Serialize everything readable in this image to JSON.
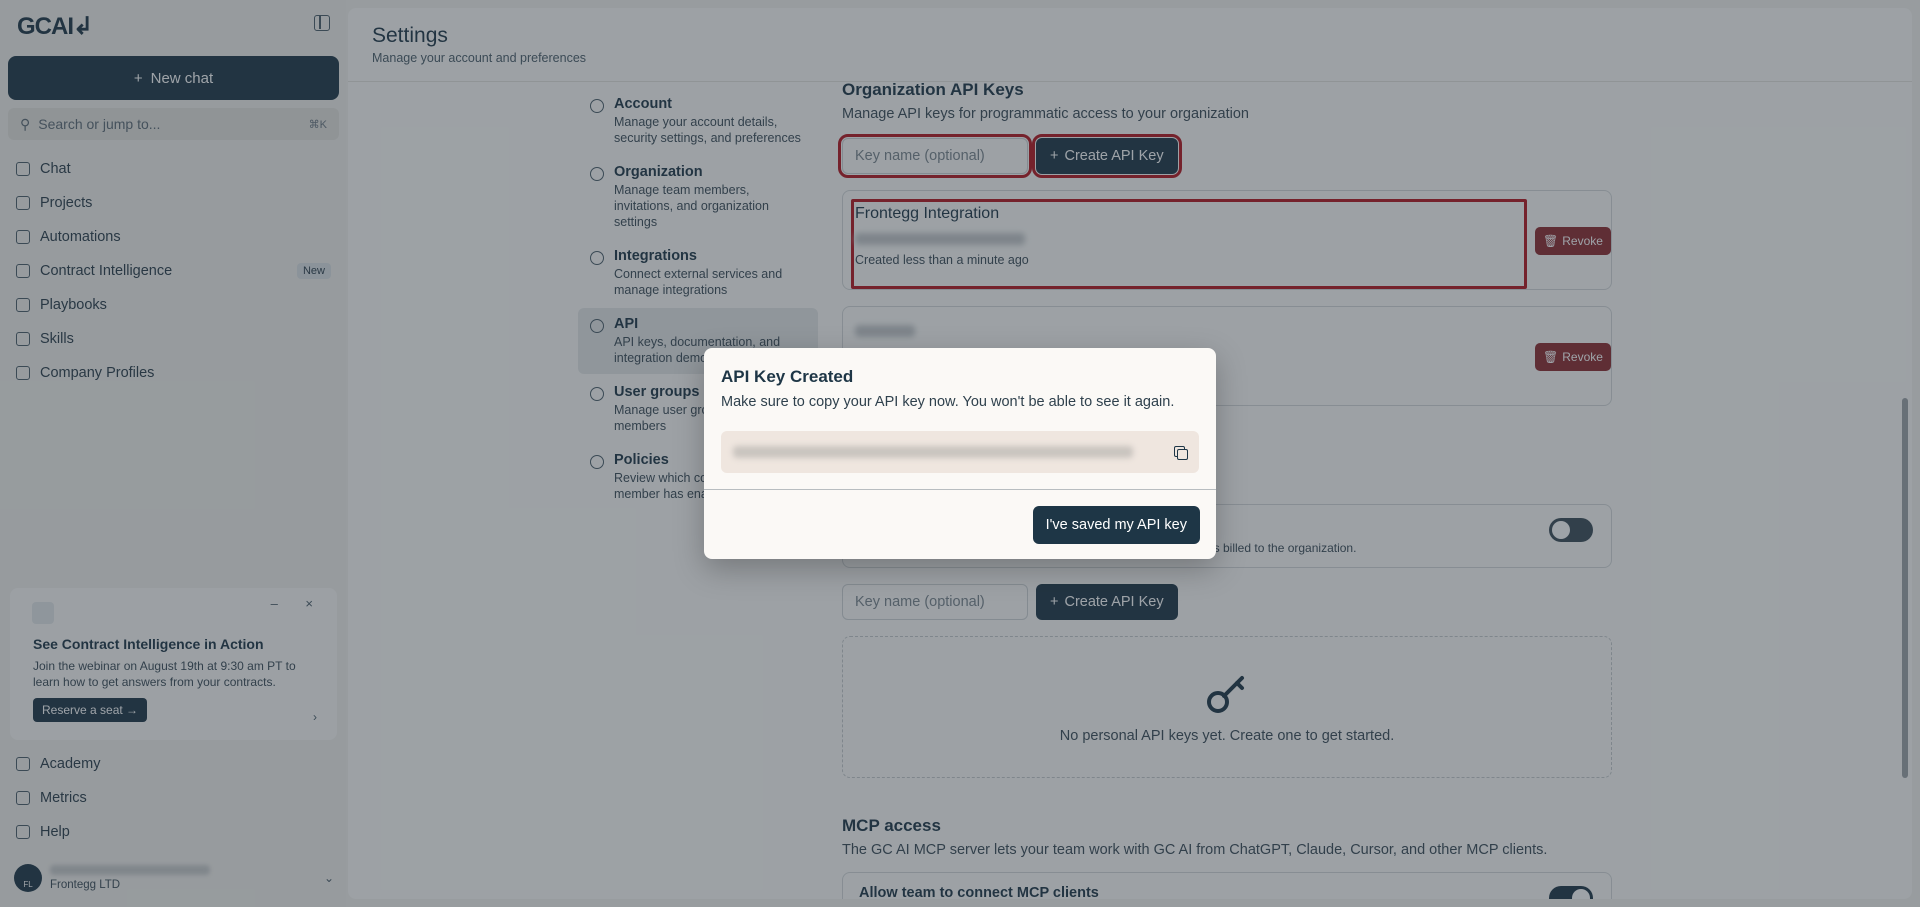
{
  "sidebar": {
    "logo": "GCAI↲",
    "new_chat": "New chat",
    "search_placeholder": "Search or jump to...",
    "search_shortcut": "⌘K",
    "items": [
      {
        "label": "Chat",
        "icon": "chat-icon"
      },
      {
        "label": "Projects",
        "icon": "folder-icon"
      },
      {
        "label": "Automations",
        "icon": "bolt-icon"
      },
      {
        "label": "Contract Intelligence",
        "icon": "document-search-icon",
        "badge": "New"
      },
      {
        "label": "Playbooks",
        "icon": "book-icon"
      },
      {
        "label": "Skills",
        "icon": "list-icon"
      },
      {
        "label": "Company Profiles",
        "icon": "building-icon"
      }
    ],
    "promo": {
      "title": "See Contract Intelligence in Action",
      "body": "Join the webinar on August 19th at 9:30 am PT to learn how to get answers from your contracts.",
      "cta": "Reserve a seat →",
      "controls": "– ×",
      "arrow": "›"
    },
    "bottom_items": [
      {
        "label": "Academy",
        "icon": "graduation-icon"
      },
      {
        "label": "Metrics",
        "icon": "chart-icon"
      },
      {
        "label": "Help",
        "icon": "help-icon"
      }
    ],
    "user": {
      "initials": "FL",
      "org": "Frontegg LTD"
    }
  },
  "header": {
    "title": "Settings",
    "subtitle": "Manage your account and preferences"
  },
  "settings_nav": [
    {
      "title": "Account",
      "desc": "Manage your account details, security settings, and preferences",
      "icon": "user-circle-icon"
    },
    {
      "title": "Organization",
      "desc": "Manage team members, invitations, and organization settings",
      "icon": "users-icon"
    },
    {
      "title": "Integrations",
      "desc": "Connect external services and manage integrations",
      "icon": "puzzle-icon"
    },
    {
      "title": "API",
      "desc": "API keys, documentation, and integration demos",
      "icon": "braces-icon",
      "active": true
    },
    {
      "title": "User groups",
      "desc": "Manage user groups and members",
      "icon": "users-icon"
    },
    {
      "title": "Policies",
      "desc": "Review which content each member has enabled",
      "icon": "shield-icon"
    }
  ],
  "org_keys": {
    "title": "Organization API Keys",
    "desc": "Manage API keys for programmatic access to your organization",
    "input_placeholder": "Key name (optional)",
    "create_label": "Create API Key",
    "keys": [
      {
        "name": "Frontegg Integration",
        "created": "Created less than a minute ago",
        "revoke": "Revoke"
      },
      {
        "revoke": "Revoke"
      }
    ]
  },
  "personal_keys": {
    "billed_text": "is billed to the organization.",
    "input_placeholder": "Key name (optional)",
    "create_label": "Create API Key",
    "empty": "No personal API keys yet. Create one to get started."
  },
  "mcp": {
    "title": "MCP access",
    "desc": "The GC AI MCP server lets your team work with GC AI from ChatGPT, Claude, Cursor, and other MCP clients.",
    "toggle_label": "Allow team to connect MCP clients"
  },
  "modal": {
    "title": "API Key Created",
    "desc": "Make sure to copy your API key now. You won't be able to see it again.",
    "confirm": "I've saved my API key"
  }
}
